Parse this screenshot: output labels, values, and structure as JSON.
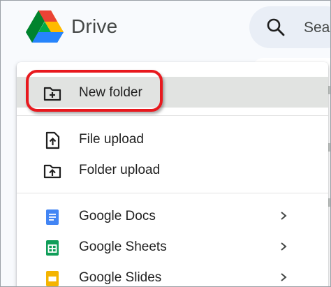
{
  "header": {
    "app_name": "Drive",
    "search_placeholder": "Sea"
  },
  "menu": {
    "items": [
      {
        "label": "New folder",
        "icon": "new-folder-icon"
      },
      {
        "label": "File upload",
        "icon": "file-upload-icon"
      },
      {
        "label": "Folder upload",
        "icon": "folder-upload-icon"
      },
      {
        "label": "Google Docs",
        "icon": "google-docs-icon",
        "has_submenu": true
      },
      {
        "label": "Google Sheets",
        "icon": "google-sheets-icon",
        "has_submenu": true
      },
      {
        "label": "Google Slides",
        "icon": "google-slides-icon",
        "has_submenu": true
      }
    ]
  },
  "colors": {
    "highlight_box": "#e8191e",
    "docs_blue": "#4285f4",
    "sheets_green": "#0f9d58",
    "slides_yellow": "#f4b400",
    "hover_gray": "#e1e3e1"
  }
}
